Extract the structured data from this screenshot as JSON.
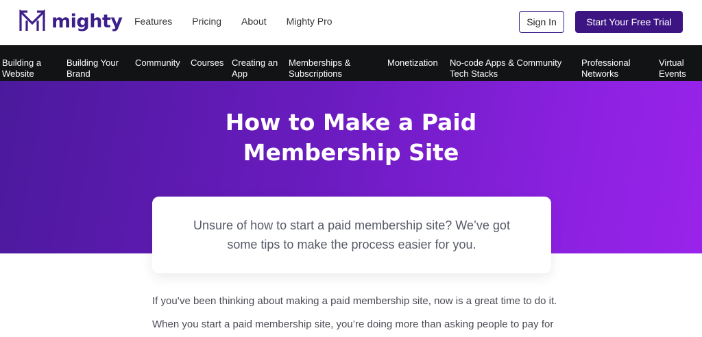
{
  "brand": {
    "name": "mighty",
    "color": "#3d1f8a"
  },
  "topnav": {
    "items": [
      "Features",
      "Pricing",
      "About",
      "Mighty Pro"
    ]
  },
  "actions": {
    "signin": "Sign In",
    "trial": "Start Your Free Trial"
  },
  "categories": [
    "Building a\nWebsite",
    "Building Your\nBrand",
    "Community",
    "Courses",
    "Creating an\nApp",
    "Memberships &\nSubscriptions",
    "Monetization",
    "No-code Apps & Community\nTech Stacks",
    "Professional\nNetworks",
    "Virtual\nEvents"
  ],
  "hero": {
    "title": "How to Make a Paid\nMembership Site",
    "subtitle": "Unsure of how to start a paid membership site? We’ve got\nsome tips to make the process easier for you."
  },
  "body": {
    "p1": "If you’ve been thinking about making a paid membership site, now is a great time to do it.",
    "p2": "When you start a paid membership site, you’re doing more than asking people to pay for"
  },
  "colors": {
    "hero_start": "#4b1a9c",
    "hero_end": "#9a23ea",
    "catbar": "#111315",
    "trial_button": "#3d1583"
  }
}
